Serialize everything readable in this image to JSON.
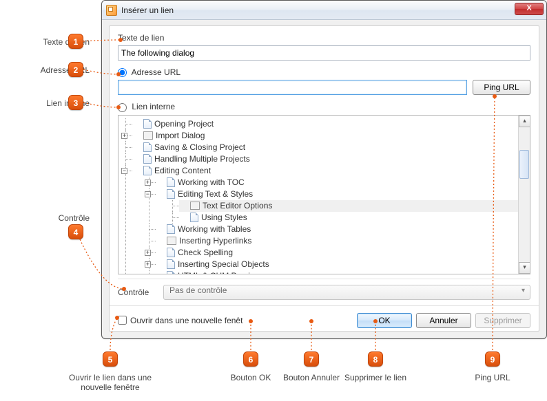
{
  "window": {
    "title": "Insérer un lien",
    "close": "X"
  },
  "linktext": {
    "label": "Texte de lien",
    "value": "The following dialog"
  },
  "url": {
    "label": "Adresse URL",
    "value": "",
    "ping": "Ping URL"
  },
  "internal": {
    "label": "Lien interne"
  },
  "tree": {
    "items": [
      "Opening Project",
      "Import Dialog",
      "Saving & Closing Project",
      "Handling Multiple Projects",
      "Editing Content",
      "Working with TOC",
      "Editing Text & Styles",
      "Text Editor Options",
      "Using Styles",
      "Working with Tables",
      "Inserting Hyperlinks",
      "Check Spelling",
      "Inserting Special Objects",
      "HTML & CHM Preview"
    ]
  },
  "control": {
    "label": "Contrôle",
    "value": "Pas de contrôle"
  },
  "newwin": {
    "label": "Ouvrir dans une nouvelle fenêt"
  },
  "buttons": {
    "ok": "OK",
    "cancel": "Annuler",
    "delete": "Supprimer"
  },
  "callouts": {
    "c1": "Texte de lien",
    "c2": "Adresse URL",
    "c3": "Lien interne",
    "c4": "Contrôle",
    "c5": "Ouvrir le lien dans une nouvelle fenêtre",
    "c6": "Bouton OK",
    "c7": "Bouton Annuler",
    "c8": "Supprimer le lien",
    "c9": "Ping URL"
  }
}
